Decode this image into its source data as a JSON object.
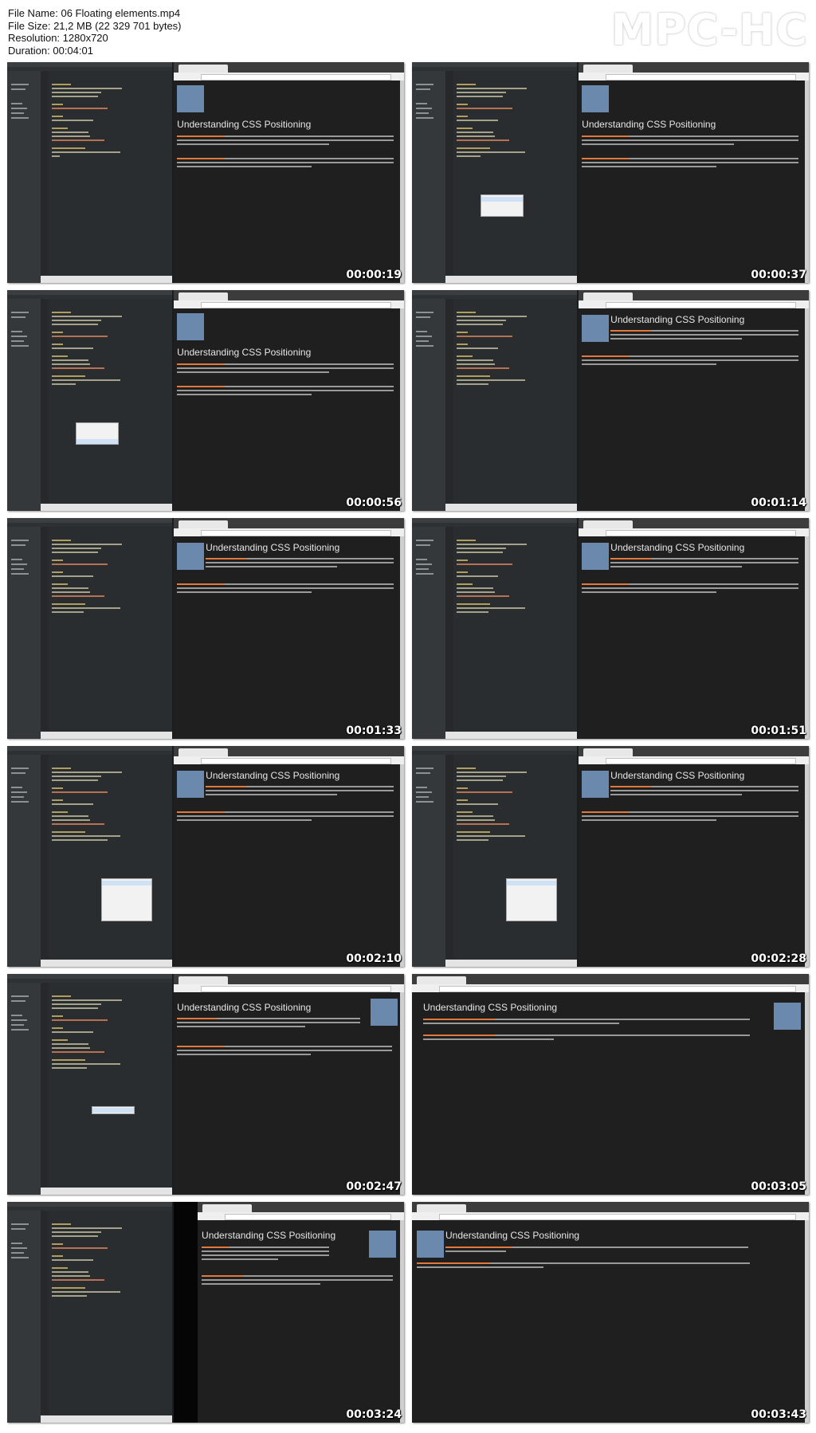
{
  "file_info": {
    "name_line": "File Name: 06 Floating elements.mp4",
    "size_line": "File Size: 21,2 MB (22 329 701 bytes)",
    "resolution_line": "Resolution: 1280x720",
    "duration_line": "Duration: 00:04:01"
  },
  "logo": "MPC-HC",
  "page_heading": "Understanding CSS Positioning",
  "thumbnails": [
    {
      "timestamp": "00:00:19"
    },
    {
      "timestamp": "00:00:37"
    },
    {
      "timestamp": "00:00:56"
    },
    {
      "timestamp": "00:01:14"
    },
    {
      "timestamp": "00:01:33"
    },
    {
      "timestamp": "00:01:51"
    },
    {
      "timestamp": "00:02:10"
    },
    {
      "timestamp": "00:02:28"
    },
    {
      "timestamp": "00:02:47"
    },
    {
      "timestamp": "00:03:05"
    },
    {
      "timestamp": "00:03:24"
    },
    {
      "timestamp": "00:03:43"
    }
  ]
}
